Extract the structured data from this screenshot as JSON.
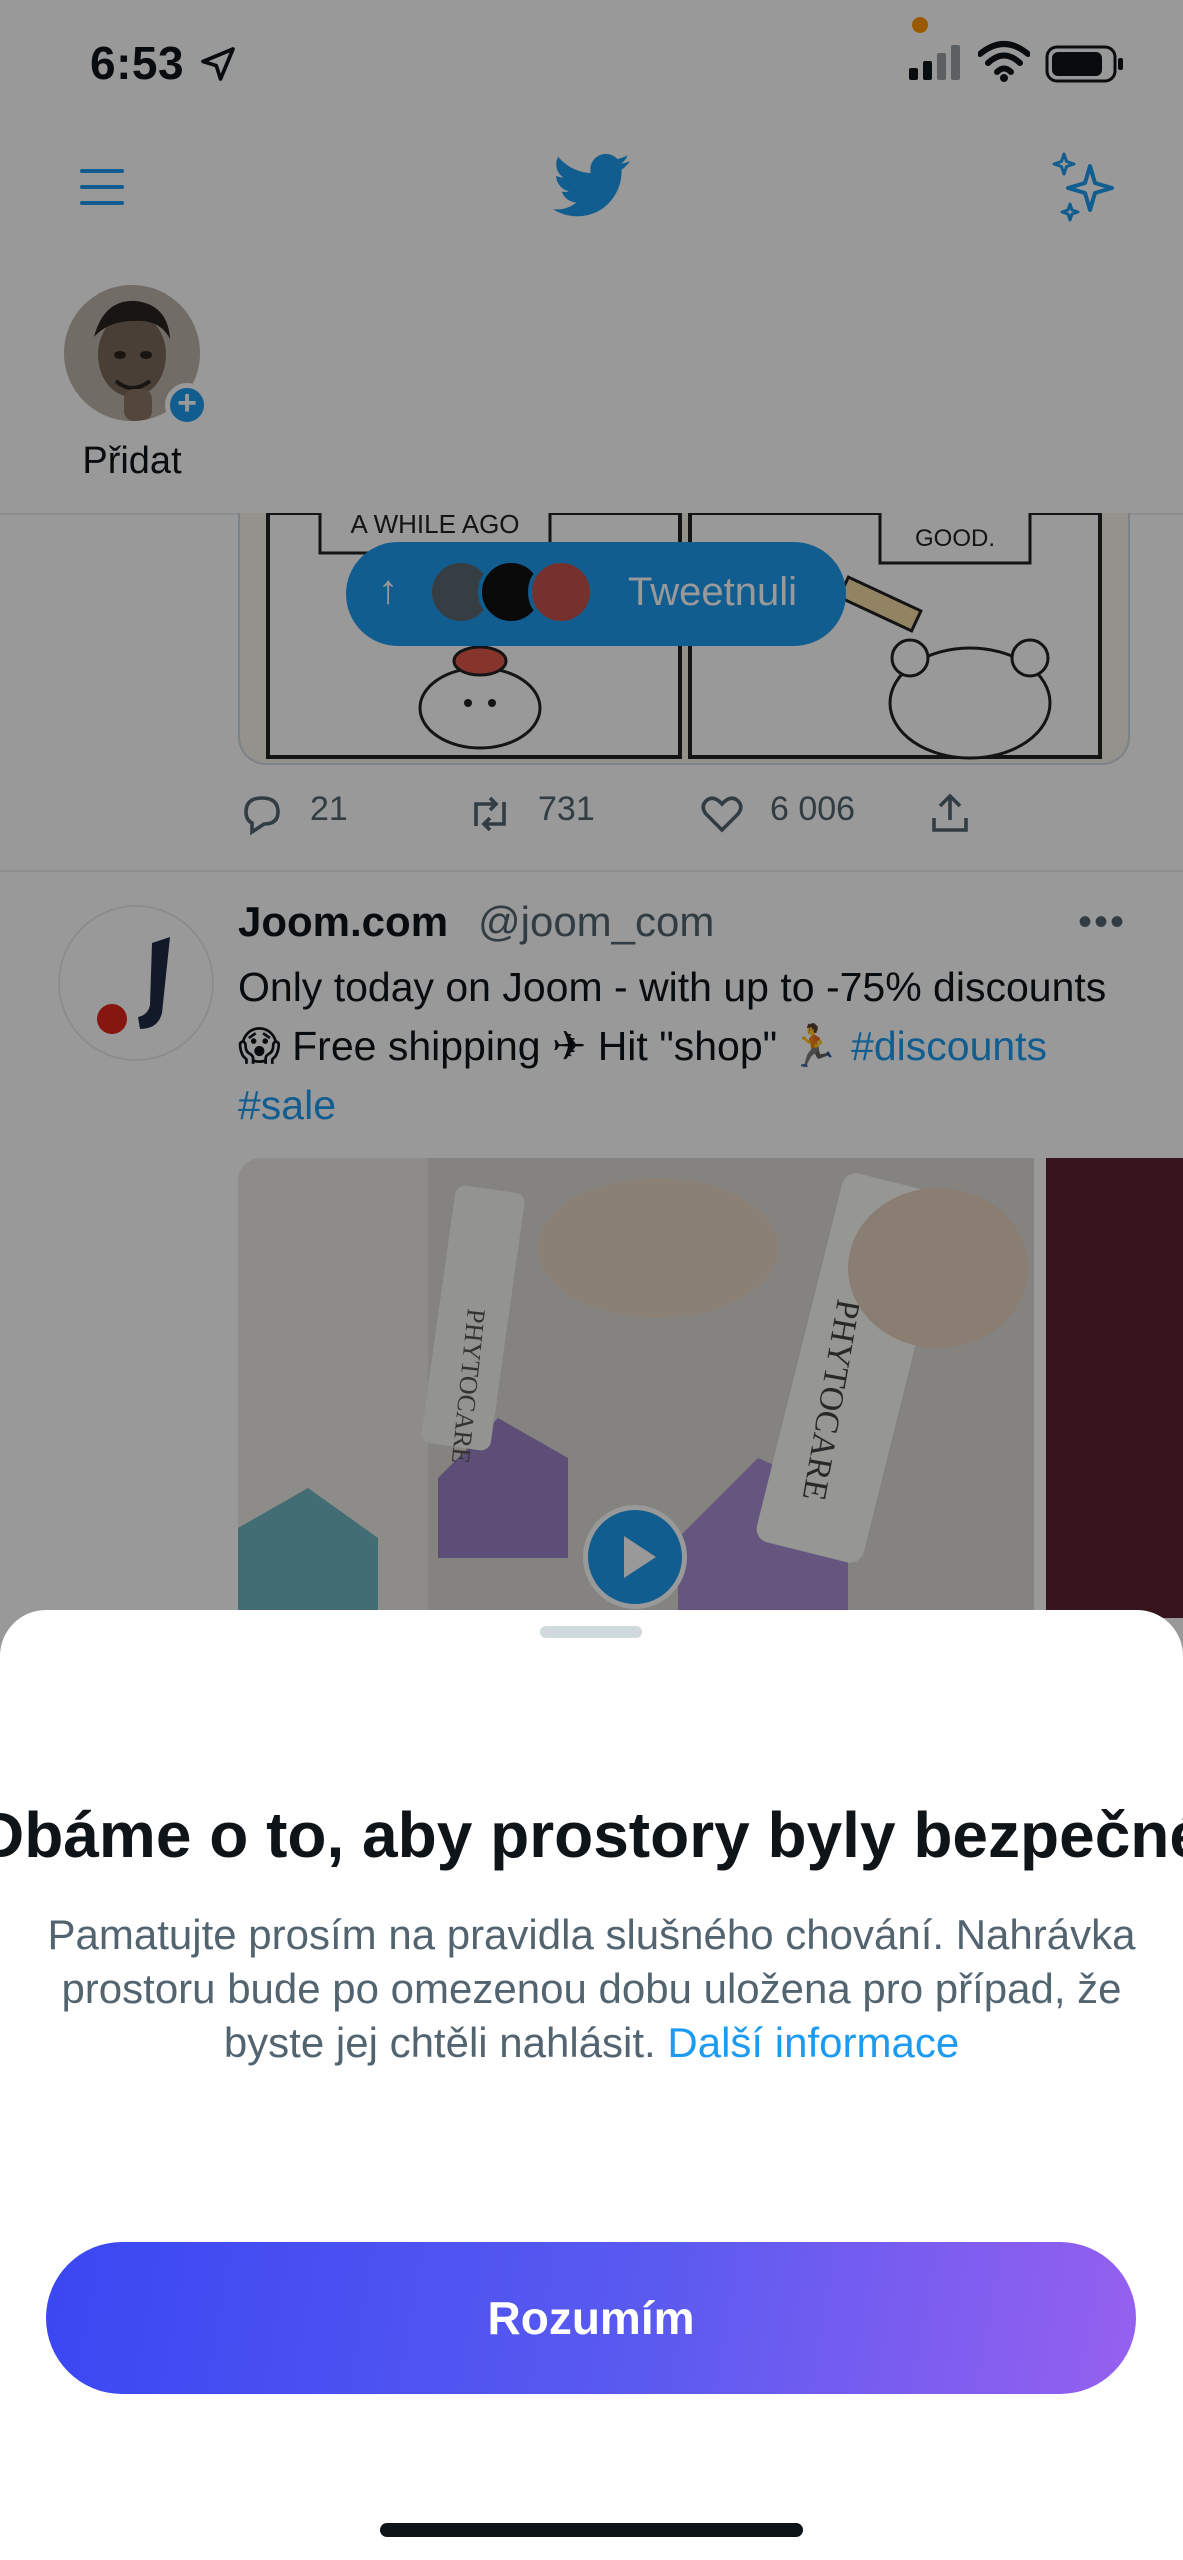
{
  "status_bar": {
    "time": "6:53"
  },
  "fleets": {
    "add_label": "Přidat"
  },
  "top_tweet": {
    "tweeted_pill_label": "Tweetnuli",
    "comic_caption_left": "A WHILE AGO",
    "comic_caption_right": "GOOD.",
    "replies": "21",
    "retweets": "731",
    "likes": "6 006"
  },
  "tweet": {
    "name": "Joom.com",
    "handle": "@joom_com",
    "more": "•••",
    "text_part1": "Only today on Joom - with up to -75% discounts 😱 Free shipping ✈ Hit \"shop\" 🏃 ",
    "hashtag1": "#discounts",
    "hashtag2": "#sale",
    "media_product": "PHYTOCARE"
  },
  "sheet": {
    "title": "Dbáme o to, aby prostory byly bezpečné",
    "body": "Pamatujte prosím na pravidla slušného chování. Nahrávka prostoru bude po omezenou dobu uložena pro případ, že byste jej chtěli nahlásit.",
    "link": "Další informace",
    "button": "Rozumím"
  },
  "colors": {
    "twitter_blue": "#1d9bf0",
    "button_gradient_start": "#3a47f2",
    "button_gradient_end": "#9660ef"
  },
  "icons": [
    "location-arrow-icon",
    "signal-icon",
    "wifi-icon",
    "battery-icon",
    "menu-icon",
    "twitter-bird-icon",
    "sparkle-icon",
    "reply-icon",
    "retweet-icon",
    "like-icon",
    "share-icon",
    "play-icon"
  ]
}
